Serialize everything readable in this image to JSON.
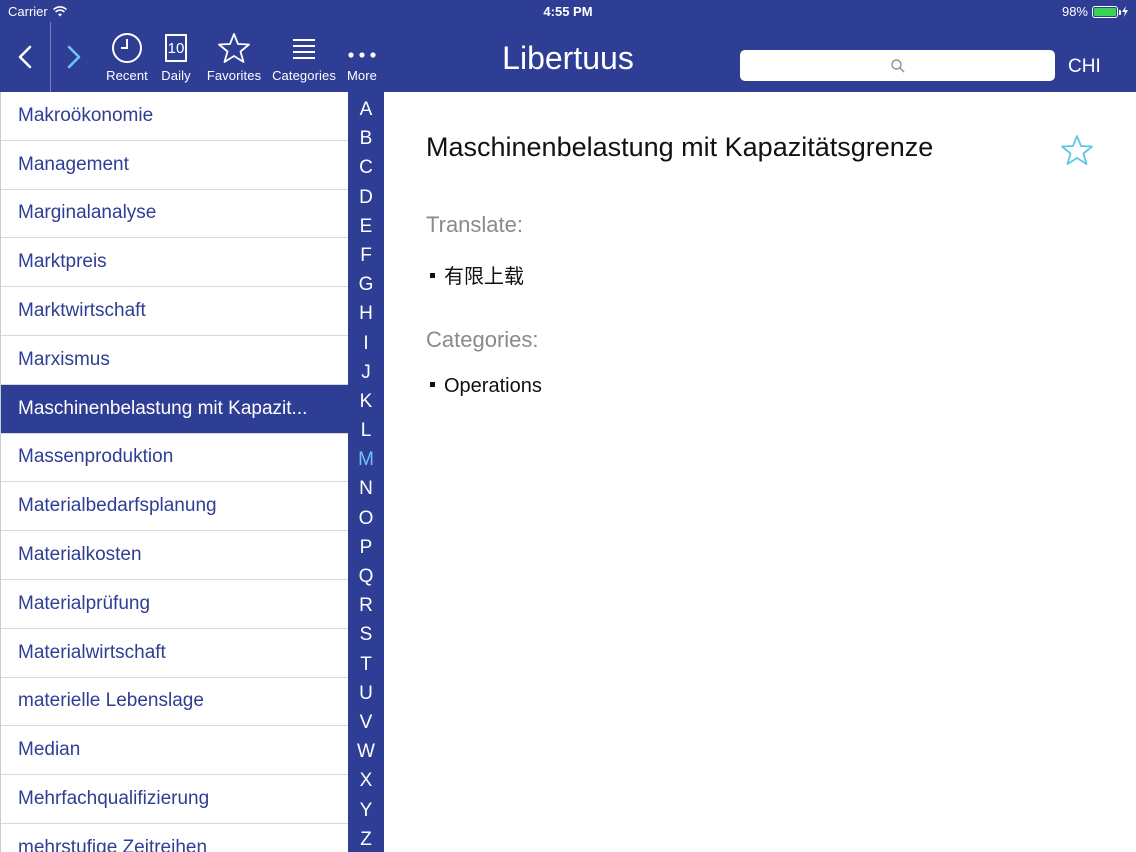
{
  "status_bar": {
    "carrier": "Carrier",
    "time": "4:55 PM",
    "battery": "98%",
    "battery_level": 0.98
  },
  "toolbar": {
    "recent": "Recent",
    "daily": "Daily",
    "daily_number": "10",
    "favorites": "Favorites",
    "categories": "Categories",
    "more": "More"
  },
  "app": {
    "title": "Libertuus",
    "language": "CHI"
  },
  "search": {
    "placeholder": "",
    "value": ""
  },
  "list": {
    "items": [
      "Makroökonomie",
      "Management",
      "Marginalanalyse",
      "Marktpreis",
      "Marktwirtschaft",
      "Marxismus",
      "Maschinenbelastung mit Kapazit...",
      "Massenproduktion",
      "Materialbedarfsplanung",
      "Materialkosten",
      "Materialprüfung",
      "Materialwirtschaft",
      "materielle Lebenslage",
      "Median",
      "Mehrfachqualifizierung",
      "mehrstufige Zeitreihen"
    ],
    "selected_index": 6
  },
  "index": {
    "letters": [
      "A",
      "B",
      "C",
      "D",
      "E",
      "F",
      "G",
      "H",
      "I",
      "J",
      "K",
      "L",
      "M",
      "N",
      "O",
      "P",
      "Q",
      "R",
      "S",
      "T",
      "U",
      "V",
      "W",
      "X",
      "Y",
      "Z"
    ],
    "active": "M"
  },
  "detail": {
    "title": "Maschinenbelastung mit Kapazitätsgrenze",
    "translate_label": "Translate:",
    "translation": "有限上载",
    "categories_label": "Categories:",
    "category": "Operations"
  },
  "colors": {
    "brand": "#2e3e94",
    "accent": "#6fc3f5",
    "star": "#5bc8e8"
  },
  "icons": {
    "back": "chevron-left-icon",
    "forward": "chevron-right-icon",
    "recent": "clock-icon",
    "daily": "calendar-icon",
    "favorites": "star-icon",
    "categories": "list-icon",
    "more": "more-dots-icon",
    "search": "search-icon"
  }
}
